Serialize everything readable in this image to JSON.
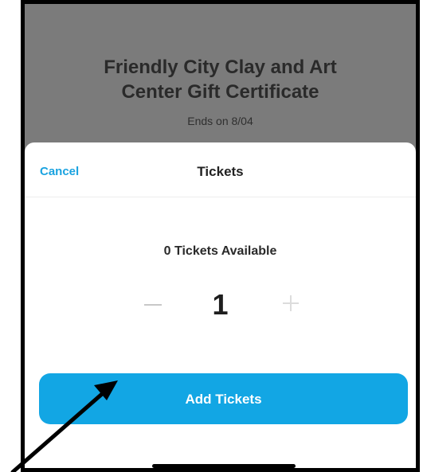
{
  "event": {
    "title": "Friendly City Clay and Art Center Gift Certificate",
    "ends": "Ends on 8/04"
  },
  "sheet": {
    "cancel_label": "Cancel",
    "title": "Tickets",
    "available_text": "0 Tickets Available",
    "quantity": "1",
    "add_button_label": "Add Tickets"
  },
  "colors": {
    "accent": "#12a6e4",
    "backdrop": "#7b7b7b",
    "link": "#1aa3e0"
  },
  "icons": {
    "minus": "minus-icon",
    "plus": "plus-icon",
    "annotation": "arrow-icon"
  }
}
